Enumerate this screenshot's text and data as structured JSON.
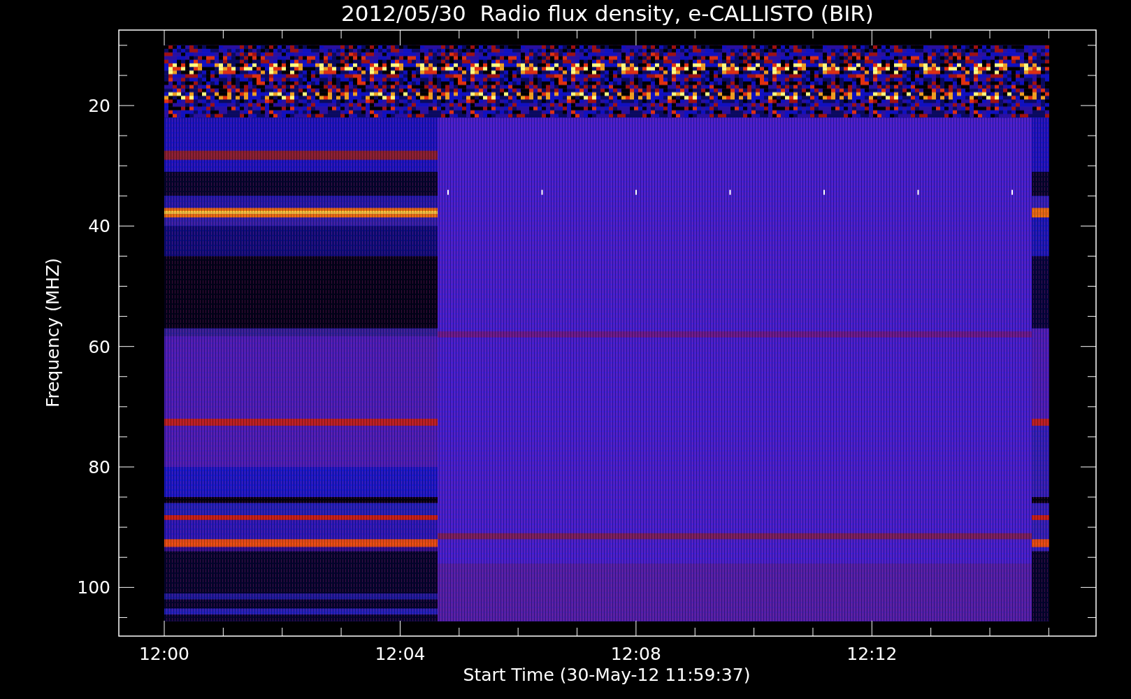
{
  "title": "2012/05/30  Radio flux density, e-CALLISTO (BIR)",
  "xlabel": "Start Time (30-May-12 11:59:37)",
  "ylabel": "Frequency (MHZ)",
  "xticks": [
    "12:00",
    "12:04",
    "12:08",
    "12:12"
  ],
  "yticks": [
    "20",
    "40",
    "60",
    "80",
    "100"
  ]
}
